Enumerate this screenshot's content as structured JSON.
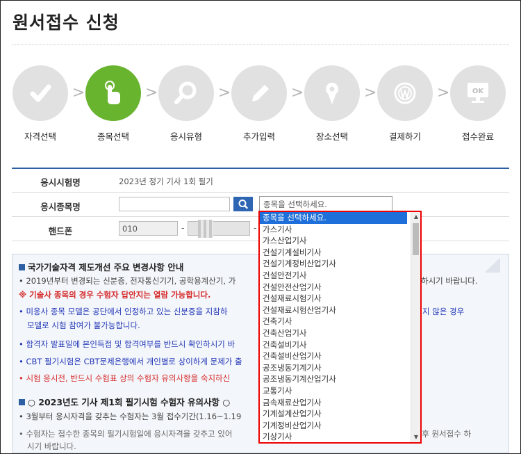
{
  "page": {
    "title": "원서접수 신청"
  },
  "steps": [
    {
      "label": "자격선택",
      "icon": "check-icon",
      "active": false
    },
    {
      "label": "종목선택",
      "icon": "pointer-hand-icon",
      "active": true
    },
    {
      "label": "응시유형",
      "icon": "magnifier-icon",
      "active": false
    },
    {
      "label": "추가입력",
      "icon": "pencil-icon",
      "active": false
    },
    {
      "label": "장소선택",
      "icon": "map-pin-icon",
      "active": false
    },
    {
      "label": "결제하기",
      "icon": "won-coin-icon",
      "active": false
    },
    {
      "label": "접수완료",
      "icon": "monitor-ok-icon",
      "active": false
    }
  ],
  "step_arrow": ">",
  "step7_screen_text": "OK",
  "form": {
    "exam_label": "응시시험명",
    "exam_value": "2023년 정기 기사 1회 필기",
    "subject_label": "응시종목명",
    "subject_input_value": "",
    "subject_select_value": "종목을 선택하세요.",
    "phone_label": "핸드폰",
    "phone_prefix": "010",
    "phone_dash": "-"
  },
  "notice": {
    "title": "국가기술자격 제도개선 주요 변경사항 안내",
    "line1": "• 2019년부터 변경되는 신분증, 전자통신기기, 공학용계산기, 가",
    "line1_tail": "하시기 바랍니다.",
    "line2": "※ 기술사 종목의 경우 수험자 답안지는 열람 가능합니다.",
    "line3": "• 미응사 종목 모델은 공단에서 인정하고 있는 신분증을 지참하",
    "line3_tail": "지 않은 경우",
    "line3b": "모델로 시험 참여가 불가능합니다.",
    "line4": "• 합격자 발표일에 본인득점 및 합격여부를 반드시 확인하시기 바",
    "line5": "• CBT 필기시험은 CBT문제은행에서 개인별로 상이하게 문제가 출",
    "line6": "• 시험 응시전, 반드시 수험표 상의 수험자 유의사항을 숙지하신",
    "title2": "○ 2023년도 기사 제1회 필기시험 수험자 유의사항 ○",
    "line7": "• 3월부터 응시자격을 갖추는 수험자는 3월 접수기간(1.16~1.19",
    "line8": "• 수험자는 접수한 종목의 필기시험일에 응시자격을 갖추고 있어",
    "line8_tail": "인 후 원서접수 하",
    "line8b": "시기 바랍니다."
  },
  "dropdown": {
    "items": [
      "종목을 선택하세요.",
      "가스기사",
      "가스산업기사",
      "건설기계설비기사",
      "건설기계정비산업기사",
      "건설안전기사",
      "건설안전산업기사",
      "건설재료시험기사",
      "건설재료시험산업기사",
      "건축기사",
      "건축산업기사",
      "건축설비기사",
      "건축설비산업기사",
      "공조냉동기계기사",
      "공조냉동기계산업기사",
      "교통기사",
      "금속재료산업기사",
      "기계설계산업기사",
      "기계정비산업기사",
      "기상기사"
    ],
    "selected_index": 0,
    "scroll_up_glyph": "▲",
    "scroll_down_glyph": "▼"
  },
  "colors": {
    "accent": "#2d5fa3",
    "active_step": "#69b42f",
    "highlight": "#1e6fd9",
    "dropdown_border": "#e00000"
  }
}
